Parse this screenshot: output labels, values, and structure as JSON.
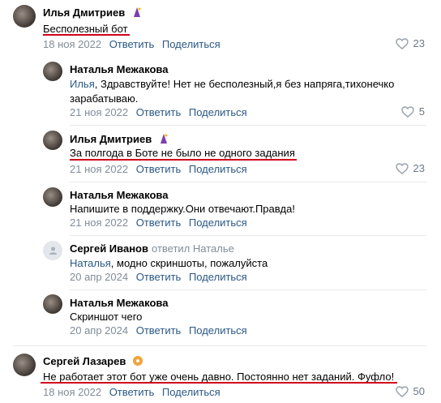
{
  "comments": [
    {
      "author": "Илья Дмитриев",
      "text": "Бесполезный бот",
      "date": "18 ноя 2022",
      "reply_label": "Ответить",
      "share_label": "Поделиться",
      "likes": "23"
    },
    {
      "author": "Наталья Межакова",
      "mention": "Илья",
      "text_line1": ", Здравствуйте! Нет не бесполезный,я без напряга,тихонечко",
      "text_line2": "зарабатываю.",
      "date": "21 ноя 2022",
      "reply_label": "Ответить",
      "share_label": "Поделиться",
      "likes": "5"
    },
    {
      "author": "Илья Дмитриев",
      "text": "За полгода в Боте не было не одного задания",
      "date": "21 ноя 2022",
      "reply_label": "Ответить",
      "share_label": "Поделиться",
      "likes": "23"
    },
    {
      "author": "Наталья Межакова",
      "text": "Напишите в поддержку.Они отвечают.Правда!",
      "date": "21 ноя 2022",
      "reply_label": "Ответить",
      "share_label": "Поделиться"
    },
    {
      "author": "Сергей Иванов",
      "reply_to": "ответил Наталье",
      "mention": "Наталья",
      "text": ", модно скриншоты, пожалуйста",
      "date": "20 апр 2024",
      "reply_label": "Ответить",
      "share_label": "Поделиться"
    },
    {
      "author": "Наталья Межакова",
      "text": "Скриншот чего",
      "date": "20 апр 2024",
      "reply_label": "Ответить",
      "share_label": "Поделиться"
    },
    {
      "author": "Сергей Лазарев",
      "text": "Не работает этот бот уже очень давно. Постоянно нет заданий. Фуфло!",
      "date": "18 ноя 2022",
      "reply_label": "Ответить",
      "share_label": "Поделиться",
      "likes": "50"
    }
  ],
  "colors": {
    "link": "#2a5885",
    "meta": "#818c99",
    "underline": "#d0021b"
  }
}
